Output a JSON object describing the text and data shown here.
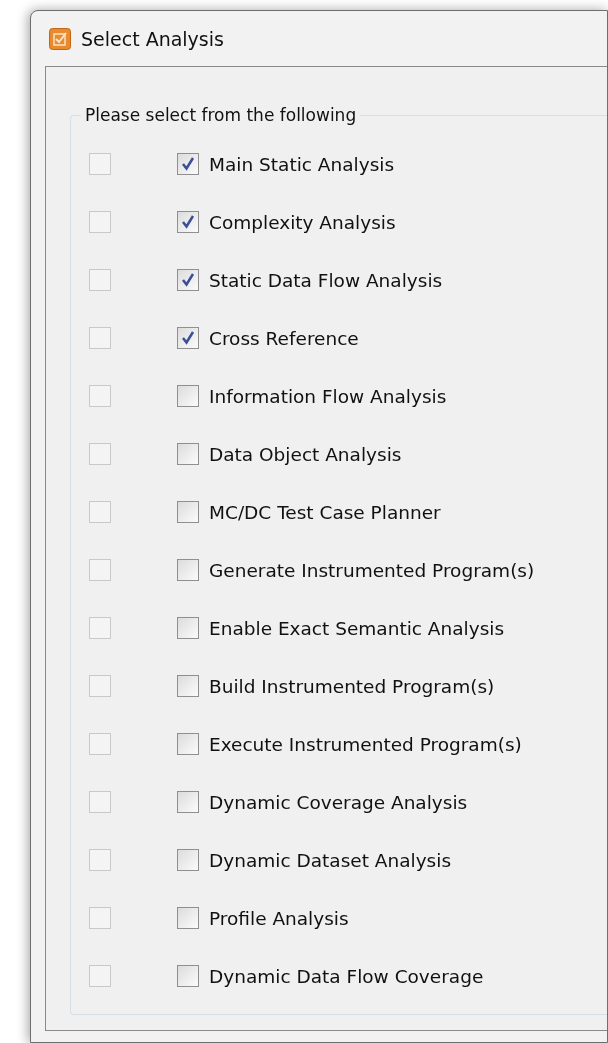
{
  "window": {
    "title": "Select Analysis"
  },
  "group": {
    "label": "Please select from the following"
  },
  "rows": [
    {
      "toggle": {
        "checked": false,
        "disabled": true
      },
      "label": "Main Static Analysis",
      "checked": true
    },
    {
      "toggle": {
        "checked": false,
        "disabled": true
      },
      "label": "Complexity Analysis",
      "checked": true
    },
    {
      "toggle": {
        "checked": false,
        "disabled": true
      },
      "label": "Static Data Flow Analysis",
      "checked": true
    },
    {
      "toggle": {
        "checked": false,
        "disabled": true
      },
      "label": "Cross Reference",
      "checked": true
    },
    {
      "toggle": {
        "checked": false,
        "disabled": true
      },
      "label": "Information Flow Analysis",
      "checked": false
    },
    {
      "toggle": {
        "checked": false,
        "disabled": true
      },
      "label": "Data Object Analysis",
      "checked": false
    },
    {
      "toggle": {
        "checked": false,
        "disabled": true
      },
      "label": "MC/DC Test Case Planner",
      "checked": false
    },
    {
      "toggle": {
        "checked": false,
        "disabled": true
      },
      "label": "Generate Instrumented Program(s)",
      "checked": false
    },
    {
      "toggle": {
        "checked": false,
        "disabled": true
      },
      "label": "Enable Exact Semantic Analysis",
      "checked": false
    },
    {
      "toggle": {
        "checked": false,
        "disabled": true
      },
      "label": "Build Instrumented Program(s)",
      "checked": false
    },
    {
      "toggle": {
        "checked": false,
        "disabled": true
      },
      "label": "Execute Instrumented Program(s)",
      "checked": false
    },
    {
      "toggle": {
        "checked": false,
        "disabled": true
      },
      "label": "Dynamic Coverage Analysis",
      "checked": false
    },
    {
      "toggle": {
        "checked": false,
        "disabled": true
      },
      "label": "Dynamic Dataset Analysis",
      "checked": false
    },
    {
      "toggle": {
        "checked": false,
        "disabled": true
      },
      "label": "Profile Analysis",
      "checked": false
    },
    {
      "toggle": {
        "checked": false,
        "disabled": true
      },
      "label": "Dynamic Data Flow Coverage",
      "checked": false
    }
  ]
}
